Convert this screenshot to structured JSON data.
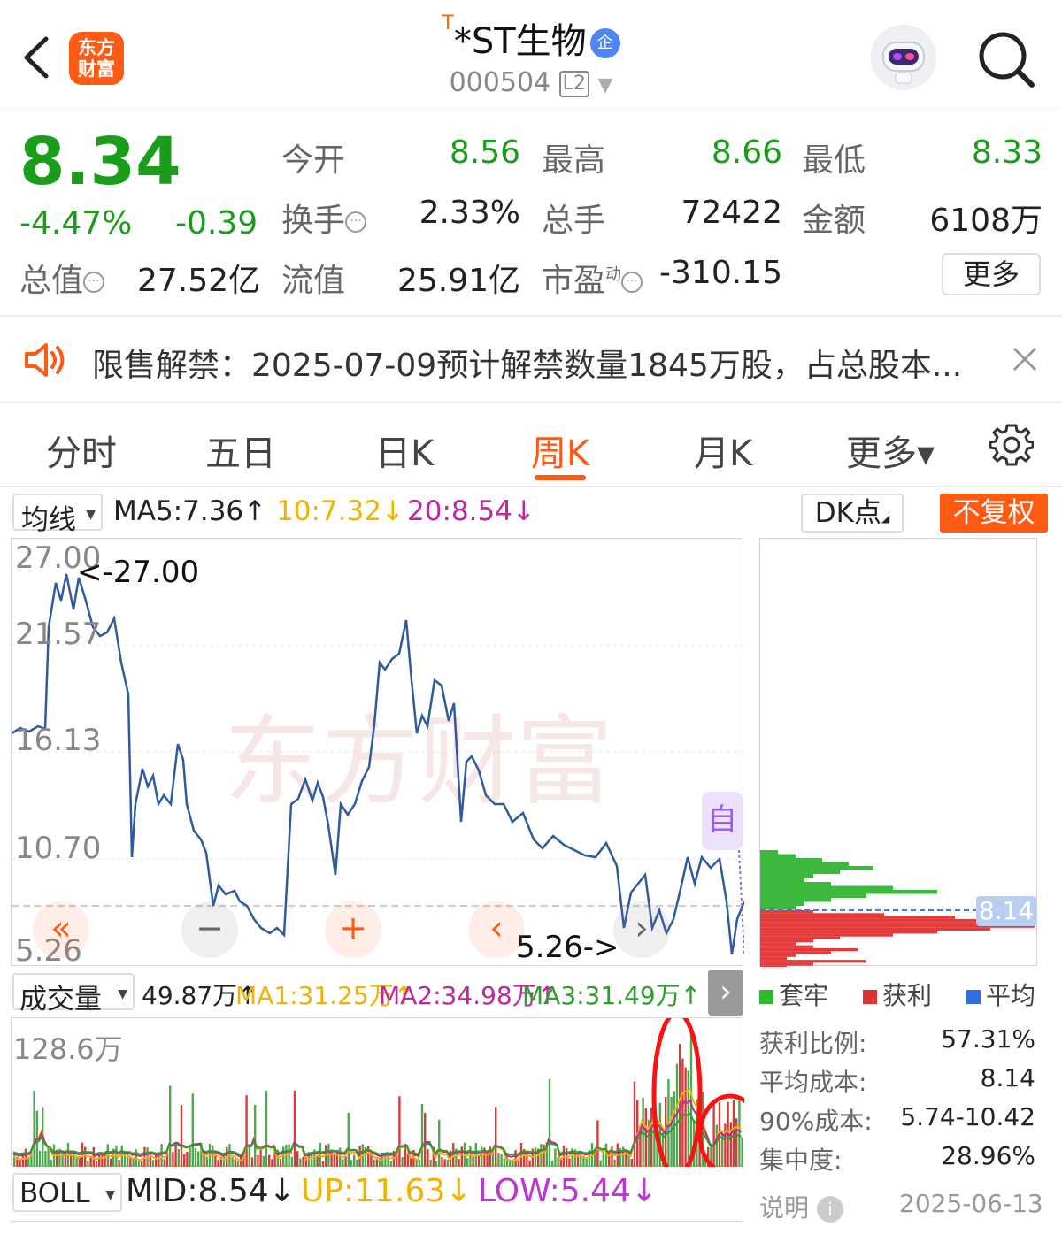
{
  "header": {
    "logo_line1": "东方",
    "logo_line2": "财富",
    "title_prefix": "T",
    "title": "*ST生物",
    "title_badge": "企",
    "code": "000504",
    "level": "L2"
  },
  "quote": {
    "price": "8.34",
    "change_pct": "-4.47%",
    "change": "-0.39",
    "open_label": "今开",
    "open": "8.56",
    "high_label": "最高",
    "high": "8.66",
    "low_label": "最低",
    "low": "8.33",
    "turnover_label": "换手",
    "turnover": "2.33%",
    "volume_label": "总手",
    "volume": "72422",
    "amount_label": "金额",
    "amount": "6108万",
    "mktcap_label": "总值",
    "mktcap": "27.52亿",
    "float_label": "流值",
    "float": "25.91亿",
    "pe_label": "市盈",
    "pe_sup": "动",
    "pe": "-310.15",
    "more_label": "更多",
    "price_color": "#1a9e1a"
  },
  "notice": {
    "text": "限售解禁：2025-07-09预计解禁数量1845万股，占总股本..."
  },
  "tabs": [
    {
      "label": "分时"
    },
    {
      "label": "五日"
    },
    {
      "label": "日K"
    },
    {
      "label": "周K",
      "active": true
    },
    {
      "label": "月K"
    },
    {
      "label": "更多▾"
    }
  ],
  "ma": {
    "selector": "均线",
    "ma5": "MA5:7.36↑",
    "ma10": "10:7.32↓",
    "ma20": "20:8.54↓",
    "dk": "DK点",
    "fuquan": "不复权"
  },
  "kchart": {
    "y_labels": [
      "27.00",
      "21.57",
      "16.13",
      "10.70",
      "5.26"
    ],
    "max_annot": "<-27.00",
    "min_annot": "5.26->",
    "self_label": "自"
  },
  "volume": {
    "selector": "成交量",
    "current": "49.87万↑",
    "ma1": "MA1:31.25万↑",
    "ma2": "MA2:34.98万↑",
    "ma3": "MA3:31.49万↑",
    "max_label": "128.6万"
  },
  "boll": {
    "selector": "BOLL",
    "mid": "MID:8.54↓",
    "up": "UP:11.63↓",
    "low": "LOW:5.44↓"
  },
  "chip": {
    "avg_cost_tag": "8.14",
    "legend": [
      "套牢",
      "获利",
      "平均"
    ],
    "stats": [
      {
        "label": "获利比例:",
        "value": "57.31%"
      },
      {
        "label": "平均成本:",
        "value": "8.14"
      },
      {
        "label": "90%成本:",
        "value": "5.74-10.42"
      },
      {
        "label": "集中度:",
        "value": "28.96%"
      }
    ],
    "note_label": "说明",
    "date": "2025-06-13"
  }
}
